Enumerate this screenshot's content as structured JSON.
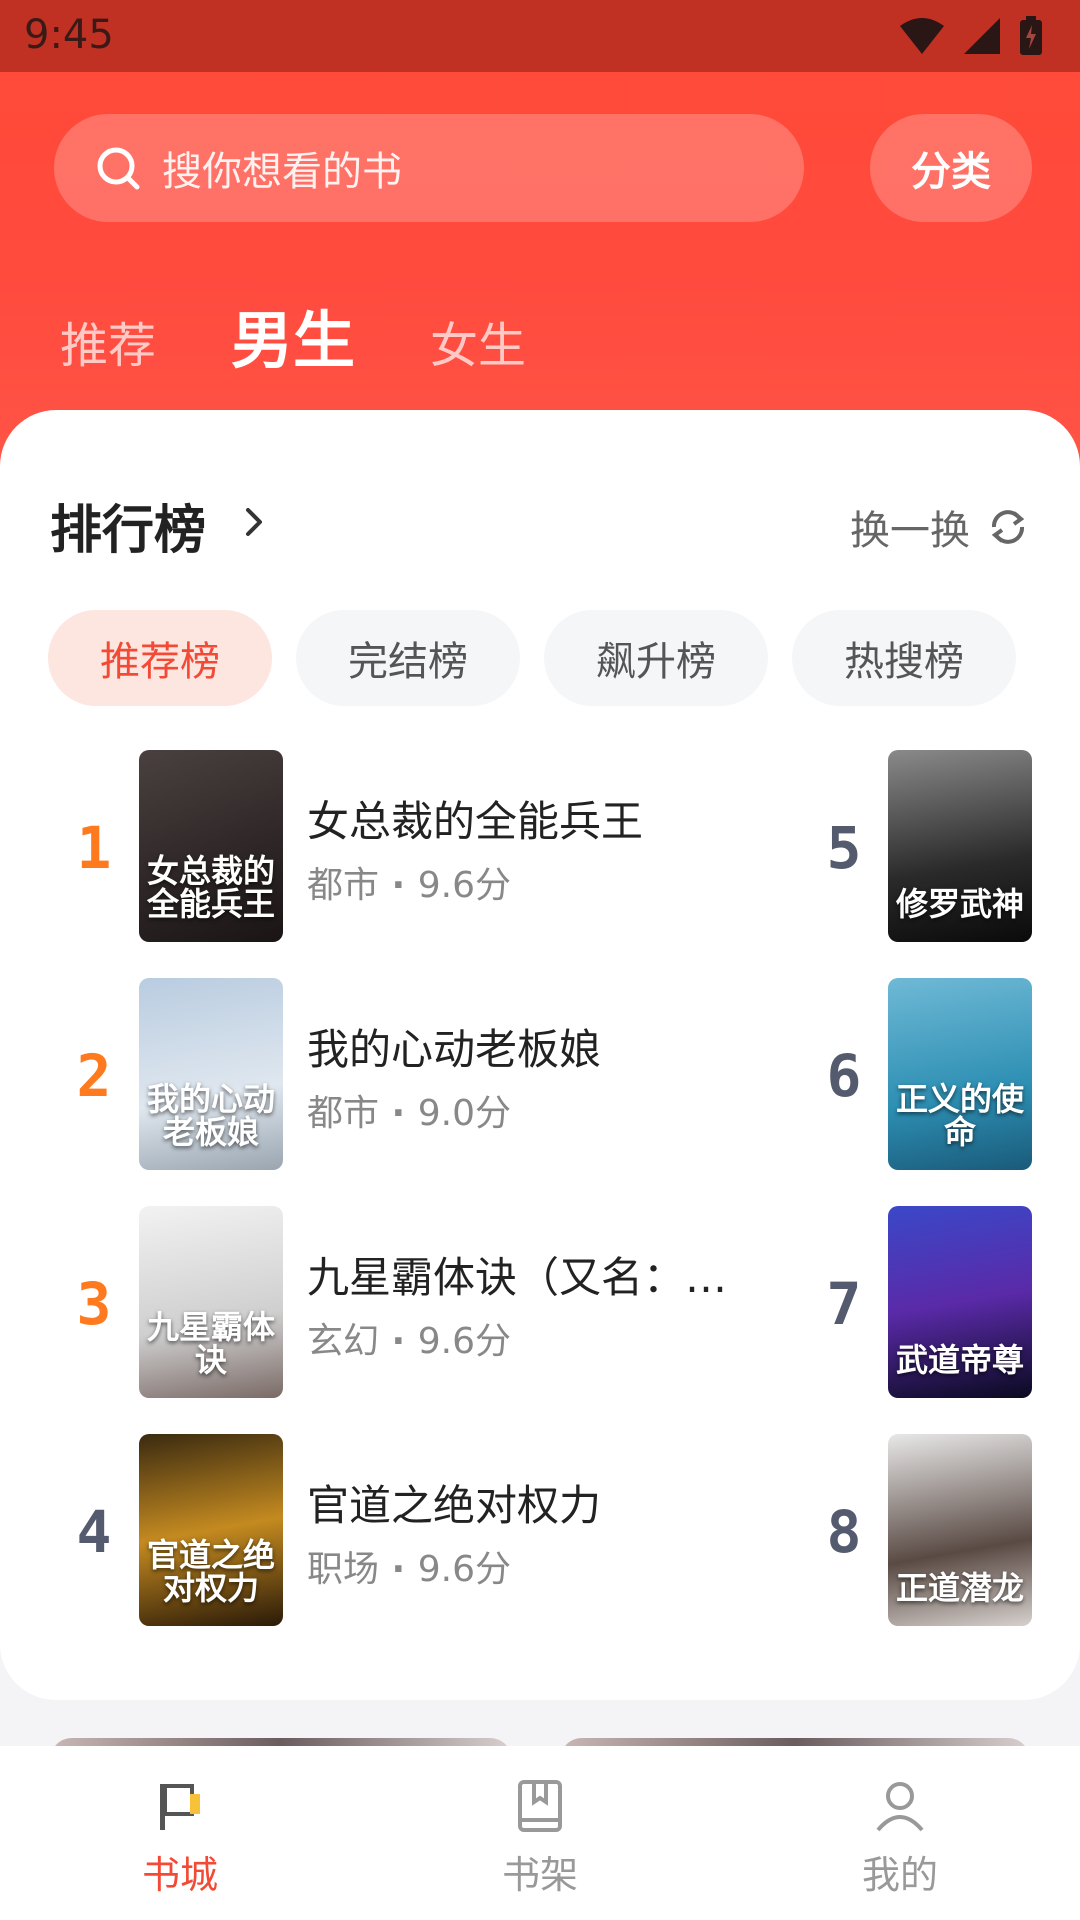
{
  "status": {
    "time": "9:45"
  },
  "search": {
    "placeholder": "搜你想看的书"
  },
  "category_label": "分类",
  "gender_tabs": [
    {
      "label": "推荐",
      "active": false
    },
    {
      "label": "男生",
      "active": true
    },
    {
      "label": "女生",
      "active": false
    }
  ],
  "ranking": {
    "title": "排行榜",
    "refresh_label": "换一换",
    "chips": [
      {
        "label": "推荐榜",
        "active": true
      },
      {
        "label": "完结榜",
        "active": false
      },
      {
        "label": "飙升榜",
        "active": false
      },
      {
        "label": "热搜榜",
        "active": false
      }
    ],
    "books": [
      {
        "rank": "1",
        "title": "女总裁的全能兵王",
        "genre": "都市",
        "score": "9.6分",
        "cover_text": "女总裁的全能兵王"
      },
      {
        "rank": "2",
        "title": "我的心动老板娘",
        "genre": "都市",
        "score": "9.0分",
        "cover_text": "我的心动老板娘"
      },
      {
        "rank": "3",
        "title": "九星霸体诀（又名：…",
        "genre": "玄幻",
        "score": "9.6分",
        "cover_text": "九星霸体诀"
      },
      {
        "rank": "4",
        "title": "官道之绝对权力",
        "genre": "职场",
        "score": "9.6分",
        "cover_text": "官道之绝对权力"
      },
      {
        "rank": "5",
        "cover_text": "修罗武神"
      },
      {
        "rank": "6",
        "cover_text": "正义的使命"
      },
      {
        "rank": "7",
        "cover_text": "武道帝尊"
      },
      {
        "rank": "8",
        "cover_text": "正道潜龙"
      }
    ]
  },
  "bottom_nav": [
    {
      "label": "书城",
      "icon": "flag-icon",
      "active": true
    },
    {
      "label": "书架",
      "icon": "book-icon",
      "active": false
    },
    {
      "label": "我的",
      "icon": "user-icon",
      "active": false
    }
  ],
  "colors": {
    "accent": "#f24a34",
    "header": "#ff4b37",
    "rank_hot": "#ff7a1e",
    "rank_cold": "#555b6e"
  }
}
